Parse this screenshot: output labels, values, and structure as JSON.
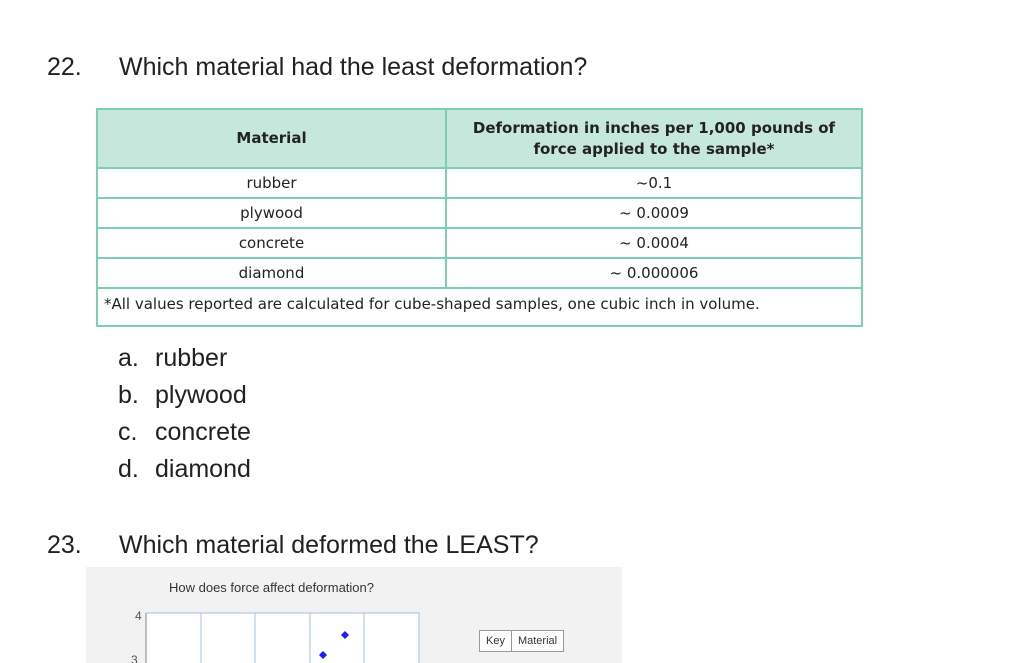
{
  "q22": {
    "number": "22.",
    "question": "Which material had the least deformation?",
    "table": {
      "headers": [
        "Material",
        "Deformation in inches per 1,000 pounds of force applied to the sample*"
      ],
      "rows": [
        [
          "rubber",
          "~0.1"
        ],
        [
          "plywood",
          "~ 0.0009"
        ],
        [
          "concrete",
          "~ 0.0004"
        ],
        [
          "diamond",
          "~ 0.000006"
        ]
      ],
      "footnote": "*All values reported are calculated for cube-shaped samples, one cubic inch in volume."
    },
    "options": [
      {
        "letter": "a.",
        "text": "rubber"
      },
      {
        "letter": "b.",
        "text": "plywood"
      },
      {
        "letter": "c.",
        "text": "concrete"
      },
      {
        "letter": "d.",
        "text": "diamond"
      }
    ]
  },
  "q23": {
    "number": "23.",
    "question": "Which material deformed the LEAST?",
    "chart": {
      "title": "How does force affect deformation?",
      "y_ticks": [
        "4",
        "3"
      ],
      "key_headers": [
        "Key",
        "Material"
      ],
      "marker_color": "#1a1aff"
    }
  }
}
